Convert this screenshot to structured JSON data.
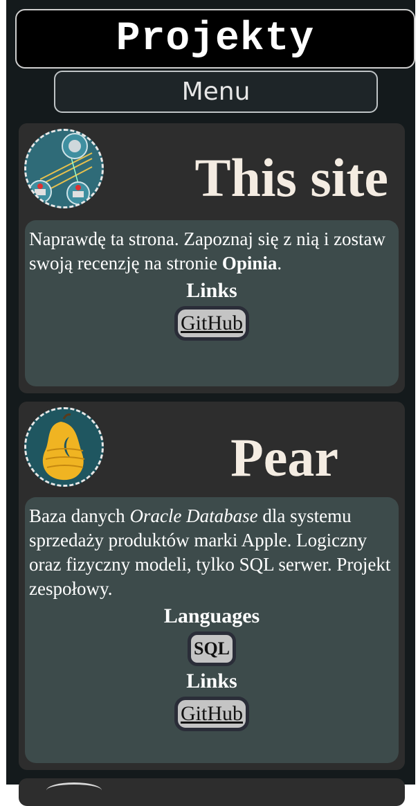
{
  "header": {
    "title": "Projekty",
    "menu_label": "Menu"
  },
  "projects": [
    {
      "title": "This site",
      "description_parts": [
        "Naprawdę ta strona. Zapoznaj się z nią i zostaw swoją recenzję na stronie ",
        "Opinia",
        "."
      ],
      "links_heading": "Links",
      "links": [
        "GitHub"
      ]
    },
    {
      "title": "Pear",
      "description_parts": [
        "Baza danych ",
        "Oracle Database",
        " dla systemu sprzedaży produktów marki Apple. Logiczny oraz fizyczny modeli, tylko SQL serwer. Projekt zespołowy."
      ],
      "languages_heading": "Languages",
      "languages": [
        "SQL"
      ],
      "links_heading": "Links",
      "links": [
        "GitHub"
      ]
    }
  ],
  "colors": {
    "page_bg": "#141a1c",
    "card_bg": "#2d2d2d",
    "desc_bg": "#3d4b4b",
    "title_color": "#f4ece2",
    "pill_bg": "#c4c4c4"
  }
}
